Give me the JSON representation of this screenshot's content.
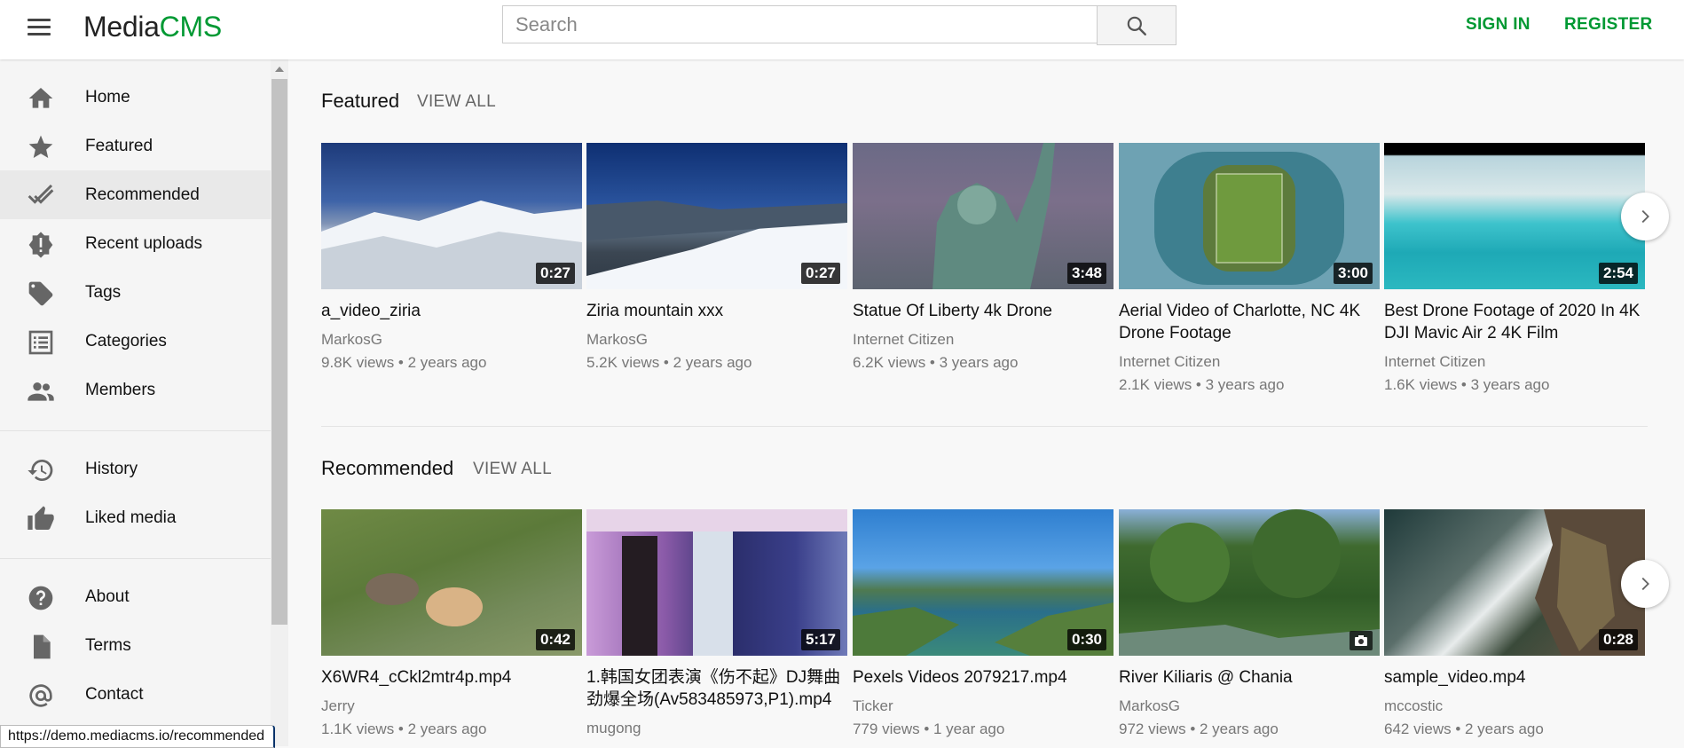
{
  "header": {
    "logo_part1": "Media",
    "logo_part2": "CMS",
    "search_placeholder": "Search",
    "sign_in": "SIGN IN",
    "register": "REGISTER",
    "accent_color": "#009933"
  },
  "sidebar": {
    "items": [
      {
        "label": "Home",
        "icon": "home-icon"
      },
      {
        "label": "Featured",
        "icon": "star-icon"
      },
      {
        "label": "Recommended",
        "icon": "check-icon",
        "active": true
      },
      {
        "label": "Recent uploads",
        "icon": "new-badge-icon"
      },
      {
        "label": "Tags",
        "icon": "tag-icon"
      },
      {
        "label": "Categories",
        "icon": "list-icon"
      },
      {
        "label": "Members",
        "icon": "people-icon"
      },
      {
        "label": "History",
        "icon": "history-icon"
      },
      {
        "label": "Liked media",
        "icon": "thumb-up-icon"
      },
      {
        "label": "About",
        "icon": "help-icon"
      },
      {
        "label": "Terms",
        "icon": "document-icon"
      },
      {
        "label": "Contact",
        "icon": "at-icon"
      }
    ]
  },
  "sections": [
    {
      "title": "Featured",
      "view_all": "VIEW ALL",
      "items": [
        {
          "title": "a_video_ziria",
          "author": "MarkosG",
          "meta": "9.8K views • 2 years ago",
          "duration": "0:27",
          "thumb": "snowy-mountain"
        },
        {
          "title": "Ziria mountain xxx",
          "author": "MarkosG",
          "meta": "5.2K views • 2 years ago",
          "duration": "0:27",
          "thumb": "mountain-valley"
        },
        {
          "title": "Statue Of Liberty 4k Drone",
          "author": "Internet Citizen",
          "meta": "6.2K views • 3 years ago",
          "duration": "3:48",
          "thumb": "statue"
        },
        {
          "title": "Aerial Video of Charlotte, NC 4K Drone Footage",
          "author": "Internet Citizen",
          "meta": "2.1K views • 3 years ago",
          "duration": "3:00",
          "thumb": "stadium"
        },
        {
          "title": "Best Drone Footage of 2020 In 4K DJI Mavic Air 2 4K Film",
          "author": "Internet Citizen",
          "meta": "1.6K views • 3 years ago",
          "duration": "2:54",
          "thumb": "ocean"
        }
      ]
    },
    {
      "title": "Recommended",
      "view_all": "VIEW ALL",
      "items": [
        {
          "title": "X6WR4_cCkl2mtr4p.mp4",
          "author": "Jerry",
          "meta": "1.1K views • 2 years ago",
          "duration": "0:42",
          "thumb": "cats-grass"
        },
        {
          "title": "1.韩国女团表演《伤不起》DJ舞曲劲爆全场(Av583485973,P1).mp4",
          "author": "mugong",
          "meta": "",
          "duration": "5:17",
          "thumb": "stage"
        },
        {
          "title": "Pexels Videos 2079217.mp4",
          "author": "Ticker",
          "meta": "779 views • 1 year ago",
          "duration": "0:30",
          "thumb": "lake"
        },
        {
          "title": "River Kiliaris @ Chania",
          "author": "MarkosG",
          "meta": "972 views • 2 years ago",
          "duration": "",
          "thumb": "river",
          "is_image": true
        },
        {
          "title": "sample_video.mp4",
          "author": "mccostic",
          "meta": "642 views • 2 years ago",
          "duration": "0:28",
          "thumb": "rocky-coast"
        }
      ]
    }
  ],
  "status_bar_url": "https://demo.mediacms.io/recommended"
}
